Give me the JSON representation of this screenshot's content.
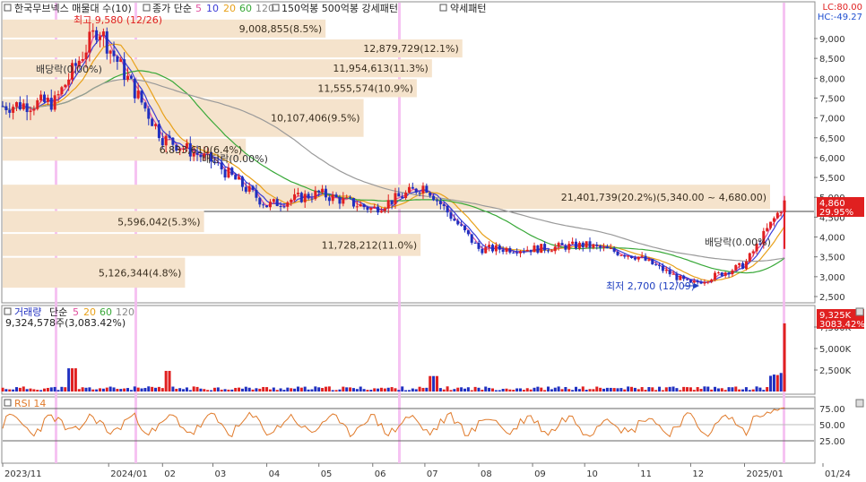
{
  "price_pane": {
    "legend": {
      "instrument": "한국무브넥스 매물대 수(10)",
      "ma_label": "종가 단순",
      "ma_periods": [
        "5",
        "10",
        "20",
        "60",
        "120"
      ],
      "extra1": "150억봉 500억봉 강세패턴",
      "extra2": "약세패턴"
    },
    "lc_text": "LC:80.00",
    "hc_text": "HC:-49.27",
    "current_price": "4,860",
    "current_change": "29.95%",
    "high_marker": "최고 9,580 (12/26)",
    "low_marker": "최저 2,700 (12/09)",
    "dividend_label_1": "배당락(0.00%)",
    "dividend_label_2": "배당락(0.00%)",
    "dividend_label_3": "배당락(0.00%)",
    "volume_profile": [
      {
        "label": "9,008,855(8.5%)",
        "price_from": 9000,
        "price_to": 9500,
        "share": 8.5
      },
      {
        "label": "12,879,729(12.1%)",
        "price_from": 8500,
        "price_to": 9000,
        "share": 12.1
      },
      {
        "label": "11,954,613(11.3%)",
        "price_from": 8000,
        "price_to": 8500,
        "share": 11.3
      },
      {
        "label": "11,555,574(10.9%)",
        "price_from": 7500,
        "price_to": 8000,
        "share": 10.9
      },
      {
        "label": "10,107,406(9.5%)",
        "price_from": 6500,
        "price_to": 7500,
        "share": 9.5
      },
      {
        "label": "6,833,610(6.4%)",
        "price_from": 5900,
        "price_to": 6500,
        "share": 6.4
      },
      {
        "label": "21,401,739(20.2%)(5,340.00 ~ 4,680.00)",
        "price_from": 4680,
        "price_to": 5340,
        "share": 20.2
      },
      {
        "label": "5,596,042(5.3%)",
        "price_from": 4100,
        "price_to": 4680,
        "share": 5.3
      },
      {
        "label": "11,728,212(11.0%)",
        "price_from": 3500,
        "price_to": 4100,
        "share": 11.0
      },
      {
        "label": "5,126,344(4.8%)",
        "price_from": 2700,
        "price_to": 3500,
        "share": 4.8
      }
    ],
    "y_ticks": [
      "9,000",
      "8,500",
      "8,000",
      "7,500",
      "7,000",
      "6,500",
      "6,000",
      "5,500",
      "5,000",
      "4,500",
      "4,000",
      "3,500",
      "3,000",
      "2,500"
    ]
  },
  "volume_pane": {
    "legend_label": "거래량",
    "ma_label": "단순",
    "ma_periods": [
      "5",
      "20",
      "60",
      "120"
    ],
    "info": "9,324,578주(3,083.42%)",
    "current_volume": "9,325K",
    "current_change": "3083.42%",
    "y_ticks": [
      "7,500K",
      "5,000K",
      "2,500K"
    ]
  },
  "rsi_pane": {
    "legend_label": "RSI 14",
    "y_ticks": [
      "75.00",
      "50.00",
      "25.00"
    ]
  },
  "x_axis": {
    "labels": [
      "2023/11",
      "2024/01",
      "02",
      "03",
      "04",
      "05",
      "06",
      "07",
      "08",
      "09",
      "10",
      "11",
      "12",
      "2025/01",
      "01/24"
    ]
  },
  "colors": {
    "ma5": "#e0509f",
    "ma10": "#3b3bd6",
    "ma20": "#e8a11a",
    "ma60": "#38a838",
    "ma120": "#9a9a9a",
    "up": "#e02020",
    "down": "#2030c0",
    "volume_profile_bar": "#f5e3cc",
    "current_price_box": "#e02020",
    "rsi_line": "#e07a2a",
    "event_band": "#f5b8f0"
  },
  "chart_data": {
    "type": "candlestick",
    "title": "한국무브넥스",
    "x_range": [
      "2023/11",
      "2025/01/24"
    ],
    "price_range": [
      2500,
      9580
    ],
    "approx_close_series": [
      {
        "date": "2023/11",
        "close": 7300
      },
      {
        "date": "2023/12",
        "close": 7400
      },
      {
        "date": "2023/12/26",
        "close": 9300
      },
      {
        "date": "2024/01",
        "close": 8800
      },
      {
        "date": "2024/02",
        "close": 6500
      },
      {
        "date": "2024/03",
        "close": 5900
      },
      {
        "date": "2024/04",
        "close": 4800
      },
      {
        "date": "2024/05",
        "close": 5100
      },
      {
        "date": "2024/06",
        "close": 4700
      },
      {
        "date": "2024/07",
        "close": 5300
      },
      {
        "date": "2024/08",
        "close": 3700
      },
      {
        "date": "2024/09",
        "close": 3700
      },
      {
        "date": "2024/10",
        "close": 3800
      },
      {
        "date": "2024/11",
        "close": 3500
      },
      {
        "date": "2024/12",
        "close": 2800
      },
      {
        "date": "2025/01",
        "close": 3300
      },
      {
        "date": "2025/01/24",
        "close": 4860
      }
    ],
    "high": {
      "value": 9580,
      "date": "12/26"
    },
    "low": {
      "value": 2700,
      "date": "12/09"
    },
    "rsi_range": [
      0,
      100
    ],
    "volume_last": 9324578
  }
}
